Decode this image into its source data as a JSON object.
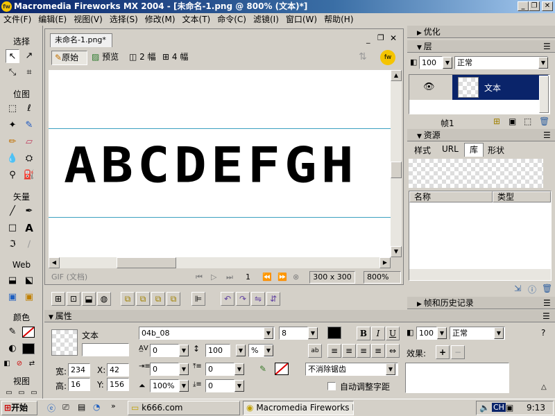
{
  "window": {
    "title": "Macromedia Fireworks MX 2004 - [未命名-1.png @ 800% (文本)*]"
  },
  "menu": [
    "文件(F)",
    "编辑(E)",
    "视图(V)",
    "选择(S)",
    "修改(M)",
    "文本(T)",
    "命令(C)",
    "滤镜(I)",
    "窗口(W)",
    "帮助(H)"
  ],
  "toolbox": {
    "select": "选择",
    "bitmap": "位图",
    "vector": "矢量",
    "web": "Web",
    "colors": "颜色",
    "view": "视图"
  },
  "document": {
    "tab": "未命名-1.png*",
    "views": [
      "原始",
      "预览",
      "2 幅",
      "4 幅"
    ],
    "canvas_text": "ABCDEFGH",
    "status_format": "GIF (文档)",
    "frame": "1",
    "size": "300 x 300",
    "zoom": "800%"
  },
  "panels": {
    "optimize": "优化",
    "layers": "层",
    "layer_opacity": "100",
    "layer_blend": "正常",
    "layer_name": "文本",
    "frame_label": "帧1",
    "assets": "资源",
    "asset_tabs": [
      "样式",
      "URL",
      "库",
      "形状"
    ],
    "asset_columns": [
      "名称",
      "类型"
    ],
    "frames_history": "帧和历史记录"
  },
  "properties": {
    "title": "属性",
    "object_type": "文本",
    "width_label": "宽:",
    "width": "234",
    "height_label": "高:",
    "height": "16",
    "x_label": "X:",
    "x": "42",
    "y_label": "Y:",
    "y": "156",
    "font": "04b_08",
    "size": "8",
    "kerning": "0",
    "leading": "100",
    "leading_unit": "%",
    "indent": "0",
    "space_before": "0",
    "space_after": "0",
    "horiz_scale": "100%",
    "baseline": "0",
    "opacity": "100",
    "blend": "正常",
    "effects_label": "效果:",
    "anti_alias": "不消除锯齿",
    "auto_kern": "自动调整字距",
    "bold": "B",
    "italic": "I",
    "underline": "U"
  },
  "taskbar": {
    "start": "开始",
    "task1": "k666.com",
    "task2": "Macromedia Fireworks MX...",
    "lang": "CH",
    "time": "9:13"
  }
}
